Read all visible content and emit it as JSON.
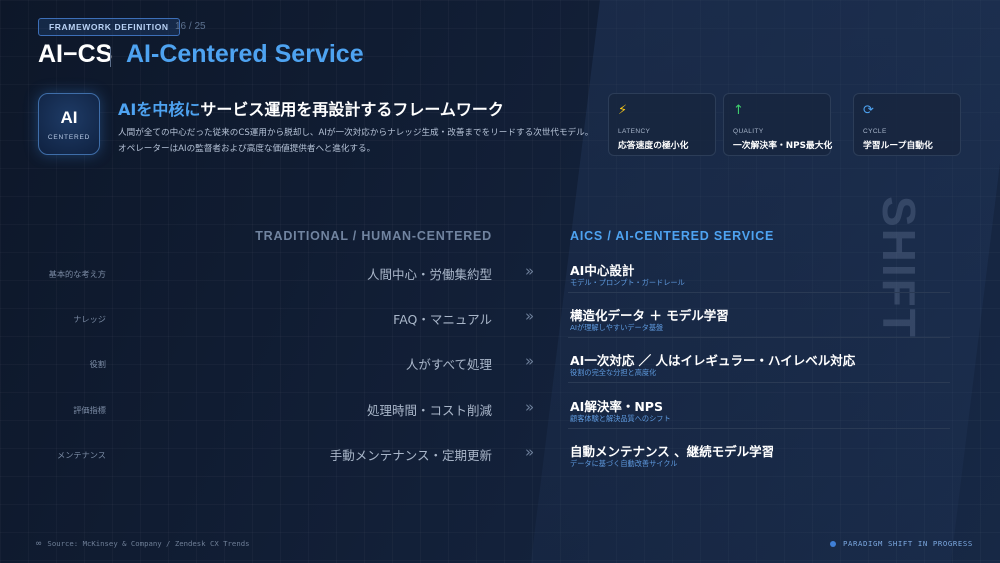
{
  "header": {
    "badge": "FRAMEWORK DEFINITION",
    "page": "16 / 25",
    "title": "AI−CS",
    "subtitle": "AI-Centered Service"
  },
  "intro": {
    "icon_title": "AI",
    "icon_caption": "CENTERED",
    "headline_highlight": "AIを中核に",
    "headline_rest": "サービス運用を再設計するフレームワーク",
    "body": "人間が全ての中心だった従来のCS運用から脱却し、AIが一次対応からナレッジ生成・改善までをリードする次世代モデル。オペレーターはAIの監督者および高度な価値提供者へと進化する。"
  },
  "metrics": [
    {
      "icon": "lightning-icon",
      "glyph": "⚡",
      "color": "#f5c518",
      "label": "LATENCY",
      "value": "応答速度の極小化"
    },
    {
      "icon": "arrow-up-icon",
      "glyph": "↑",
      "color": "#3ecf6e",
      "label": "QUALITY",
      "value": "一次解決率・NPS最大化"
    },
    {
      "icon": "refresh-icon",
      "glyph": "⟳",
      "color": "#4ea3f1",
      "label": "CYCLE",
      "value": "学習ループ自動化"
    }
  ],
  "watermark": "SHIFT",
  "table": {
    "left_header": "TRADITIONAL / HUMAN-CENTERED",
    "right_header": "AICS / AI-CENTERED SERVICE",
    "arrow": "»",
    "rows": [
      {
        "category": "基本的な考え方",
        "traditional": "人間中心・労働集約型",
        "ai_main": "AI中心設計",
        "ai_sub": "モデル・プロンプト・ガードレール"
      },
      {
        "category": "ナレッジ",
        "traditional": "FAQ・マニュアル",
        "ai_main": "構造化データ ＋ モデル学習",
        "ai_sub": "AIが理解しやすいデータ基盤"
      },
      {
        "category": "役割",
        "traditional": "人がすべて処理",
        "ai_main": "AI一次対応 ／ 人はイレギュラー・ハイレベル対応",
        "ai_sub": "役割の完全な分担と高度化"
      },
      {
        "category": "評価指標",
        "traditional": "処理時間・コスト削減",
        "ai_main": "AI解決率・NPS",
        "ai_sub": "顧客体験と解決品質へのシフト"
      },
      {
        "category": "メンテナンス",
        "traditional": "手動メンテナンス・定期更新",
        "ai_main": "自動メンテナンス 、継続モデル学習",
        "ai_sub": "データに基づく自動改善サイクル"
      }
    ]
  },
  "footer": {
    "source": "Source: McKinsey & Company / Zendesk CX Trends",
    "status": "PARADIGM SHIFT IN PROGRESS"
  }
}
